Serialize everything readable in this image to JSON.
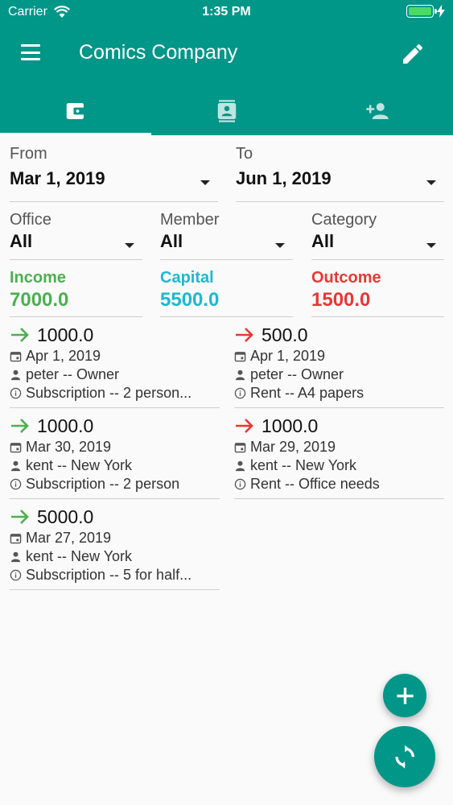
{
  "status_bar": {
    "carrier": "Carrier",
    "time": "1:35 PM"
  },
  "app_bar": {
    "title": "Comics Company"
  },
  "tabs": [
    {
      "icon": "wallet-icon",
      "active": true
    },
    {
      "icon": "contacts-icon",
      "active": false
    },
    {
      "icon": "add-person-icon",
      "active": false
    }
  ],
  "filters": {
    "from": {
      "label": "From",
      "value": "Mar 1, 2019"
    },
    "to": {
      "label": "To",
      "value": "Jun 1, 2019"
    },
    "office": {
      "label": "Office",
      "value": "All"
    },
    "member": {
      "label": "Member",
      "value": "All"
    },
    "category": {
      "label": "Category",
      "value": "All"
    }
  },
  "summary": {
    "income": {
      "label": "Income",
      "value": "7000.0",
      "color": "#4caf50"
    },
    "capital": {
      "label": "Capital",
      "value": "5500.0",
      "color": "#1eb8d0"
    },
    "outcome": {
      "label": "Outcome",
      "value": "1500.0",
      "color": "#e53935"
    }
  },
  "income_transactions": [
    {
      "amount": "1000.0",
      "date": "Apr 1, 2019",
      "member": "peter -- Owner",
      "info": "Subscription -- 2 person..."
    },
    {
      "amount": "1000.0",
      "date": "Mar 30, 2019",
      "member": "kent -- New York",
      "info": "Subscription -- 2 person"
    },
    {
      "amount": "5000.0",
      "date": "Mar 27, 2019",
      "member": "kent -- New York",
      "info": "Subscription -- 5 for half..."
    }
  ],
  "outcome_transactions": [
    {
      "amount": "500.0",
      "date": "Apr 1, 2019",
      "member": "peter -- Owner",
      "info": "Rent -- A4 papers"
    },
    {
      "amount": "1000.0",
      "date": "Mar 29, 2019",
      "member": "kent -- New York",
      "info": "Rent -- Office needs"
    }
  ],
  "colors": {
    "primary": "#009688",
    "income_arrow": "#4caf50",
    "outcome_arrow": "#e53935"
  }
}
